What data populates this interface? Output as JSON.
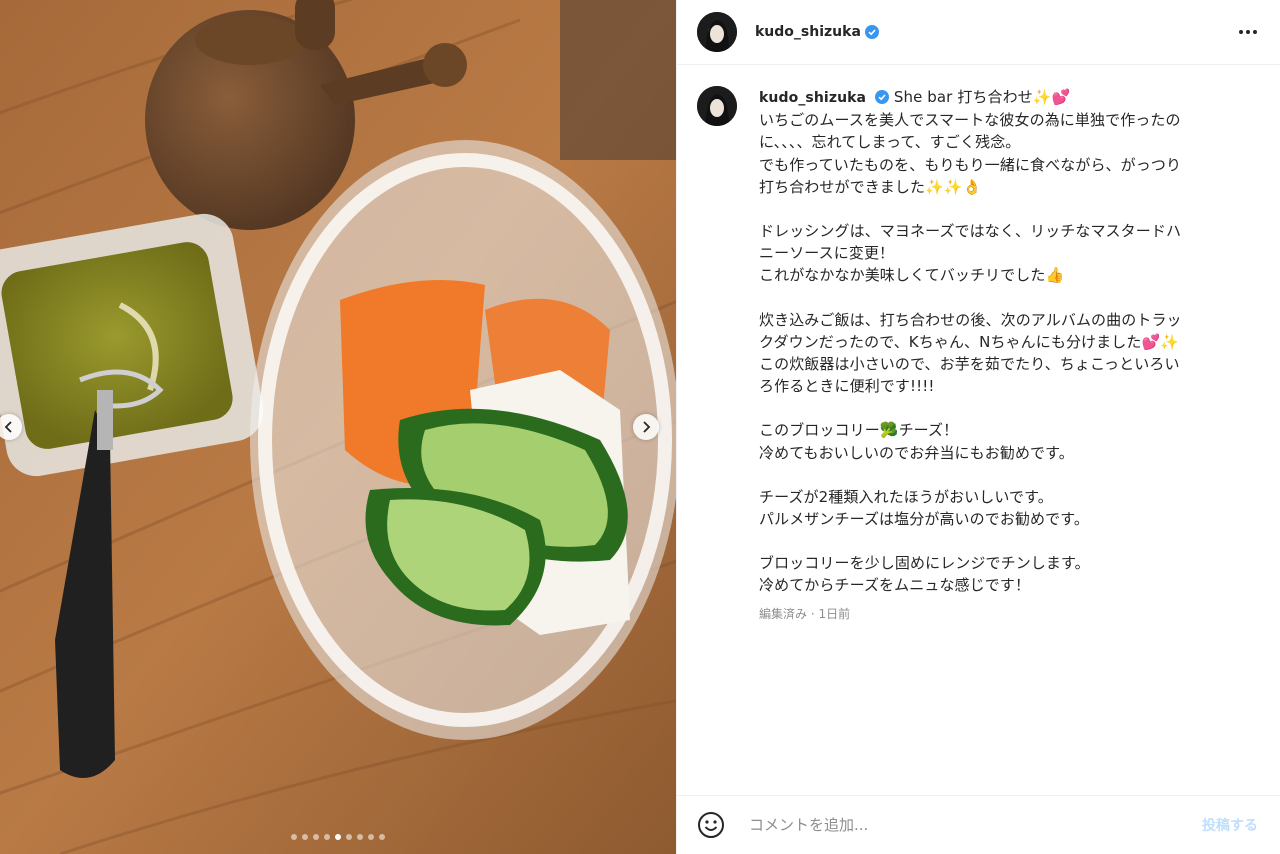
{
  "post": {
    "username": "kudo_shizuka",
    "verified": true,
    "caption_title": "She bar 打ち合わせ✨💕",
    "caption_paragraphs": [
      [
        "いちごのムースを美人でスマートな彼女の為に単独で作ったの",
        "に、、、、忘れてしまって、すごく残念。",
        "でも作っていたものを、もりもり一緒に食べながら、がっつり",
        "打ち合わせができました✨✨👌"
      ],
      [
        "ドレッシングは、マヨネーズではなく、リッチなマスタードハ",
        "ニーソースに変更！",
        "これがなかなか美味しくてバッチリでした👍"
      ],
      [
        "炊き込みご飯は、打ち合わせの後、次のアルバムの曲のトラッ",
        "クダウンだったので、Kちゃん、Nちゃんにも分けました💕✨",
        "この炊飯器は小さいので、お芋を茹でたり、ちょこっといろい",
        "ろ作るときに便利です!!!!"
      ],
      [
        "このブロッコリー🥦チーズ！",
        "冷めてもおいしいのでお弁当にもお勧めです。"
      ],
      [
        "チーズが2種類入れたほうがおいしいです。",
        "パルメザンチーズは塩分が高いのでお勧めです。"
      ],
      [
        "ブロッコリーを少し固めにレンジでチンします。",
        "冷めてからチーズをムニュな感じです！"
      ]
    ],
    "meta": "編集済み · 1日前"
  },
  "carousel": {
    "total_images": 9,
    "active_index": 4,
    "prev_icon": "chevron-left-icon",
    "next_icon": "chevron-right-icon"
  },
  "comment": {
    "placeholder": "コメントを追加...",
    "submit_label": "投稿する",
    "emoji_icon": "smiley-icon"
  },
  "colors": {
    "verified_blue": "#3897f0",
    "post_button_disabled": "#c0dffd",
    "meta_gray": "#8e8e8e"
  }
}
